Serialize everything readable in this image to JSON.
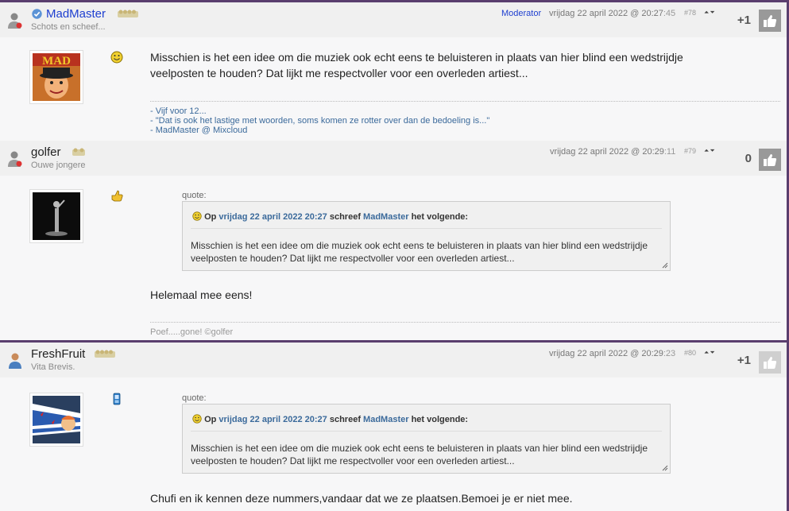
{
  "posts": [
    {
      "username": "MadMaster",
      "user_title": "Schots en scheef...",
      "role": "Moderator",
      "date": "vrijdag 22 april 2022 @ 20:27",
      "seconds": ":45",
      "post_number": "#78",
      "arrows": "⏶⏷",
      "score": "+1",
      "message": "Misschien is het een idee om die muziek ook echt eens te beluisteren in plaats van hier blind een wedstrijdje veelposten te houden? Dat lijkt me respectvoller voor een overleden artiest...",
      "signature": [
        "- Vijf voor 12...",
        "- \"Dat is ook het lastige met woorden, soms komen ze rotter over dan de bedoeling is...\"",
        "- MadMaster @ Mixcloud"
      ],
      "avatar_text": "MAD"
    },
    {
      "username": "golfer",
      "user_title": "Ouwe jongere",
      "date": "vrijdag 22 april 2022 @ 20:29",
      "seconds": ":11",
      "post_number": "#79",
      "arrows": "⏶⏷",
      "score": "0",
      "quote": {
        "label": "quote:",
        "prefix": "Op",
        "date": "vrijdag 22 april 2022 20:27",
        "wrote": "schreef",
        "author": "MadMaster",
        "suffix": "het volgende:",
        "text": "Misschien is het een idee om die muziek ook echt eens te beluisteren in plaats van hier blind een wedstrijdje veelposten te houden? Dat lijkt me respectvoller voor een overleden artiest..."
      },
      "message": "Helemaal mee eens!",
      "signature": [
        "Poef.....gone! ©golfer"
      ]
    },
    {
      "username": "FreshFruit",
      "user_title": "Vita Brevis.",
      "date": "vrijdag 22 april 2022 @ 20:29",
      "seconds": ":23",
      "post_number": "#80",
      "arrows": "⏶⏷",
      "score": "+1",
      "quote": {
        "label": "quote:",
        "prefix": "Op",
        "date": "vrijdag 22 april 2022 20:27",
        "wrote": "schreef",
        "author": "MadMaster",
        "suffix": "het volgende:",
        "text": "Misschien is het een idee om die muziek ook echt eens te beluisteren in plaats van hier blind een wedstrijdje veelposten te houden? Dat lijkt me respectvoller voor een overleden artiest..."
      },
      "message": "Chufi en ik kennen deze nummers,vandaar dat we ze plaatsen.Bemoei je er niet mee."
    }
  ],
  "colors": {
    "accent": "#5a3e6e",
    "link": "#3b6a9b",
    "moderator": "#1e3fd0",
    "like_button": "#999999"
  },
  "icons": {
    "user": "user-icon",
    "verified": "verified-badge-icon",
    "rank": "rank-stars-icon",
    "like": "thumbs-up-icon",
    "smiley": "smiley-icon",
    "thumbs_mood": "thumbs-up-mood-icon",
    "mobile": "mobile-phone-icon"
  }
}
